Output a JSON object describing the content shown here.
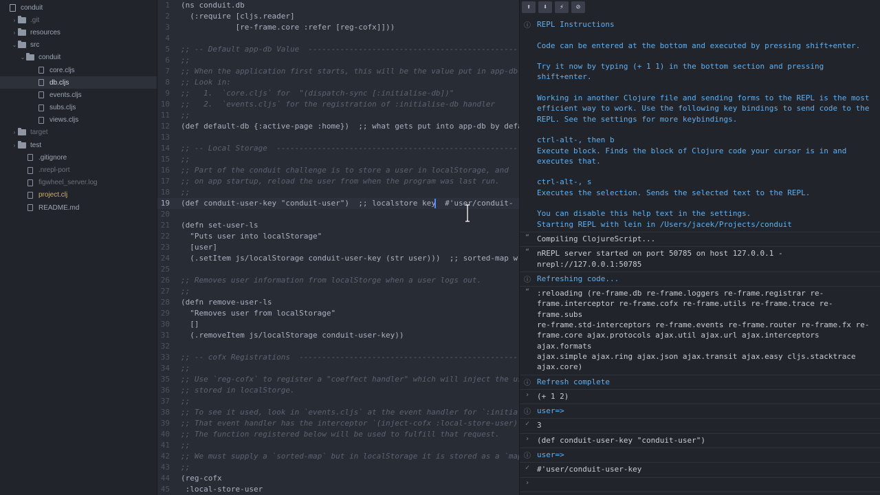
{
  "sidebar": {
    "items": [
      {
        "label": "conduit",
        "arrow": "",
        "icon": "repo",
        "indent": 4,
        "style": ""
      },
      {
        "label": ".git",
        "arrow": "›",
        "icon": "folder",
        "indent": 16,
        "style": "muted"
      },
      {
        "label": "resources",
        "arrow": "›",
        "icon": "folder",
        "indent": 16,
        "style": ""
      },
      {
        "label": "src",
        "arrow": "⌄",
        "icon": "folder",
        "indent": 16,
        "style": ""
      },
      {
        "label": "conduit",
        "arrow": "⌄",
        "icon": "folder",
        "indent": 28,
        "style": ""
      },
      {
        "label": "core.cljs",
        "arrow": "",
        "icon": "file",
        "indent": 44,
        "style": ""
      },
      {
        "label": "db.cljs",
        "arrow": "",
        "icon": "file",
        "indent": 44,
        "style": "selected"
      },
      {
        "label": "events.cljs",
        "arrow": "",
        "icon": "file",
        "indent": 44,
        "style": ""
      },
      {
        "label": "subs.cljs",
        "arrow": "",
        "icon": "file",
        "indent": 44,
        "style": ""
      },
      {
        "label": "views.cljs",
        "arrow": "",
        "icon": "file",
        "indent": 44,
        "style": ""
      },
      {
        "label": "target",
        "arrow": "›",
        "icon": "folder",
        "indent": 16,
        "style": "muted"
      },
      {
        "label": "test",
        "arrow": "›",
        "icon": "folder",
        "indent": 16,
        "style": ""
      },
      {
        "label": ".gitignore",
        "arrow": "",
        "icon": "file",
        "indent": 28,
        "style": ""
      },
      {
        "label": ".nrepl-port",
        "arrow": "",
        "icon": "file",
        "indent": 28,
        "style": "muted"
      },
      {
        "label": "figwheel_server.log",
        "arrow": "",
        "icon": "file",
        "indent": 28,
        "style": "muted"
      },
      {
        "label": "project.clj",
        "arrow": "",
        "icon": "file",
        "indent": 28,
        "style": "yellow"
      },
      {
        "label": "README.md",
        "arrow": "",
        "icon": "file",
        "indent": 28,
        "style": ""
      }
    ]
  },
  "editor": {
    "cursor_line": 19,
    "lines": [
      {
        "n": "1",
        "text": "(ns conduit.db",
        "kind": "code"
      },
      {
        "n": "2",
        "text": "  (:require [cljs.reader]",
        "kind": "code"
      },
      {
        "n": "3",
        "text": "            [re-frame.core :refer [reg-cofx]]))",
        "kind": "code"
      },
      {
        "n": "4",
        "text": "",
        "kind": "code"
      },
      {
        "n": "5",
        "text": ";; -- Default app-db Value  ---------------------------------------------------",
        "kind": "comment"
      },
      {
        "n": "6",
        "text": ";;",
        "kind": "comment"
      },
      {
        "n": "7",
        "text": ";; When the application first starts, this will be the value put in app-db",
        "kind": "comment"
      },
      {
        "n": "8",
        "text": ";; Look in:",
        "kind": "comment"
      },
      {
        "n": "9",
        "text": ";;   1.  `core.cljs` for  \"(dispatch-sync [:initialise-db])\"",
        "kind": "comment"
      },
      {
        "n": "10",
        "text": ";;   2.  `events.cljs` for the registration of :initialise-db handler",
        "kind": "comment"
      },
      {
        "n": "11",
        "text": ";;",
        "kind": "comment"
      },
      {
        "n": "12",
        "text": "(def default-db {:active-page :home})  ;; what gets put into app-db by default.",
        "kind": "code"
      },
      {
        "n": "13",
        "text": "",
        "kind": "code"
      },
      {
        "n": "14",
        "text": ";; -- Local Storage  ----------------------------------------------------------",
        "kind": "comment"
      },
      {
        "n": "15",
        "text": ";;",
        "kind": "comment"
      },
      {
        "n": "16",
        "text": ";; Part of the conduit challenge is to store a user in localStorage, and",
        "kind": "comment"
      },
      {
        "n": "17",
        "text": ";; on app startup, reload the user from when the program was last run.",
        "kind": "comment"
      },
      {
        "n": "18",
        "text": ";;",
        "kind": "comment"
      },
      {
        "n": "19",
        "text": "(def conduit-user-key \"conduit-user\")  ;; localstore key  #'user/conduit-",
        "kind": "code"
      },
      {
        "n": "20",
        "text": "",
        "kind": "code"
      },
      {
        "n": "21",
        "text": "(defn set-user-ls",
        "kind": "code"
      },
      {
        "n": "22",
        "text": "  \"Puts user into localStorage\"",
        "kind": "code"
      },
      {
        "n": "23",
        "text": "  [user]",
        "kind": "code"
      },
      {
        "n": "24",
        "text": "  (.setItem js/localStorage conduit-user-key (str user)))  ;; sorted-map written as an EDN map",
        "kind": "code"
      },
      {
        "n": "25",
        "text": "",
        "kind": "code"
      },
      {
        "n": "26",
        "text": ";; Removes user information from localStorge when a user logs out.",
        "kind": "comment"
      },
      {
        "n": "27",
        "text": ";;",
        "kind": "comment"
      },
      {
        "n": "28",
        "text": "(defn remove-user-ls",
        "kind": "code"
      },
      {
        "n": "29",
        "text": "  \"Removes user from localStorage\"",
        "kind": "code"
      },
      {
        "n": "30",
        "text": "  []",
        "kind": "code"
      },
      {
        "n": "31",
        "text": "  (.removeItem js/localStorage conduit-user-key))",
        "kind": "code"
      },
      {
        "n": "32",
        "text": "",
        "kind": "code"
      },
      {
        "n": "33",
        "text": ";; -- cofx Registrations  -----------------------------------------------------",
        "kind": "comment"
      },
      {
        "n": "34",
        "text": ";;",
        "kind": "comment"
      },
      {
        "n": "35",
        "text": ";; Use `reg-cofx` to register a \"coeffect handler\" which will inject the user",
        "kind": "comment"
      },
      {
        "n": "36",
        "text": ";; stored in localStorge.",
        "kind": "comment"
      },
      {
        "n": "37",
        "text": ";;",
        "kind": "comment"
      },
      {
        "n": "38",
        "text": ";; To see it used, look in `events.cljs` at the event handler for `:initialise-db`.",
        "kind": "comment"
      },
      {
        "n": "39",
        "text": ";; That event handler has the interceptor `(inject-cofx :local-store-user)`",
        "kind": "comment"
      },
      {
        "n": "40",
        "text": ";; The function registered below will be used to fulfill that request.",
        "kind": "comment"
      },
      {
        "n": "41",
        "text": ";;",
        "kind": "comment"
      },
      {
        "n": "42",
        "text": ";; We must supply a `sorted-map` but in localStorage it is stored as a `map`.",
        "kind": "comment"
      },
      {
        "n": "43",
        "text": ";;",
        "kind": "comment"
      },
      {
        "n": "44",
        "text": "(reg-cofx",
        "kind": "code"
      },
      {
        "n": "45",
        "text": " :local-store-user",
        "kind": "code"
      }
    ]
  },
  "repl": {
    "toolbar": [
      {
        "glyph": "⬆",
        "name": "history-up-button"
      },
      {
        "glyph": "⬇",
        "name": "history-down-button"
      },
      {
        "glyph": "⚡",
        "name": "interrupt-button"
      },
      {
        "glyph": "⊘",
        "name": "clear-button"
      }
    ],
    "entries": [
      {
        "icon": "ⓘ",
        "style": "info",
        "lines": [
          "REPL Instructions",
          "",
          "Code can be entered at the bottom and executed by pressing shift+enter.",
          "",
          "Try it now by typing (+ 1 1) in the bottom section and pressing",
          "shift+enter.",
          "",
          "Working in another Clojure file and sending forms to the REPL is the most",
          "efficient way to work. Use the following key bindings to send code to the",
          "REPL. See the settings for more keybindings.",
          "",
          "ctrl-alt-, then b",
          "Execute block. Finds the block of Clojure code your cursor is in and",
          "executes that.",
          "",
          "ctrl-alt-, s",
          "Executes the selection. Sends the selected text to the REPL.",
          "",
          "You can disable this help text in the settings.",
          "Starting REPL with lein in /Users/jacek/Projects/conduit"
        ]
      },
      {
        "icon": "“",
        "style": "plain",
        "lines": [
          "Compiling ClojureScript..."
        ]
      },
      {
        "icon": "“",
        "style": "plain",
        "lines": [
          "nREPL server started on port 50785 on host 127.0.0.1 -",
          "nrepl://127.0.0.1:50785"
        ]
      },
      {
        "icon": "ⓘ",
        "style": "info",
        "lines": [
          "Refreshing code..."
        ]
      },
      {
        "icon": "“",
        "style": "plain",
        "lines": [
          ":reloading (re-frame.db re-frame.loggers re-frame.registrar re-",
          "frame.interceptor re-frame.cofx re-frame.utils re-frame.trace re-frame.subs",
          "re-frame.std-interceptors re-frame.events re-frame.router re-frame.fx re-",
          "frame.core ajax.protocols ajax.util ajax.url ajax.interceptors ajax.formats",
          "ajax.simple ajax.ring ajax.json ajax.transit ajax.easy cljs.stacktrace",
          "ajax.core)"
        ]
      },
      {
        "icon": "ⓘ",
        "style": "info",
        "lines": [
          "Refresh complete"
        ]
      },
      {
        "icon": "›",
        "style": "plain",
        "lines": [
          "(+ 1 2)"
        ]
      },
      {
        "icon": "ⓘ",
        "style": "info",
        "lines": [
          "user=>"
        ]
      },
      {
        "icon": "✓",
        "style": "plain",
        "lines": [
          "3"
        ]
      },
      {
        "icon": "›",
        "style": "plain",
        "lines": [
          "(def conduit-user-key \"conduit-user\")"
        ]
      },
      {
        "icon": "ⓘ",
        "style": "info",
        "lines": [
          "user=>"
        ]
      },
      {
        "icon": "✓",
        "style": "plain",
        "lines": [
          "#'user/conduit-user-key"
        ]
      },
      {
        "icon": "›",
        "style": "plain",
        "lines": [
          ""
        ]
      }
    ]
  }
}
